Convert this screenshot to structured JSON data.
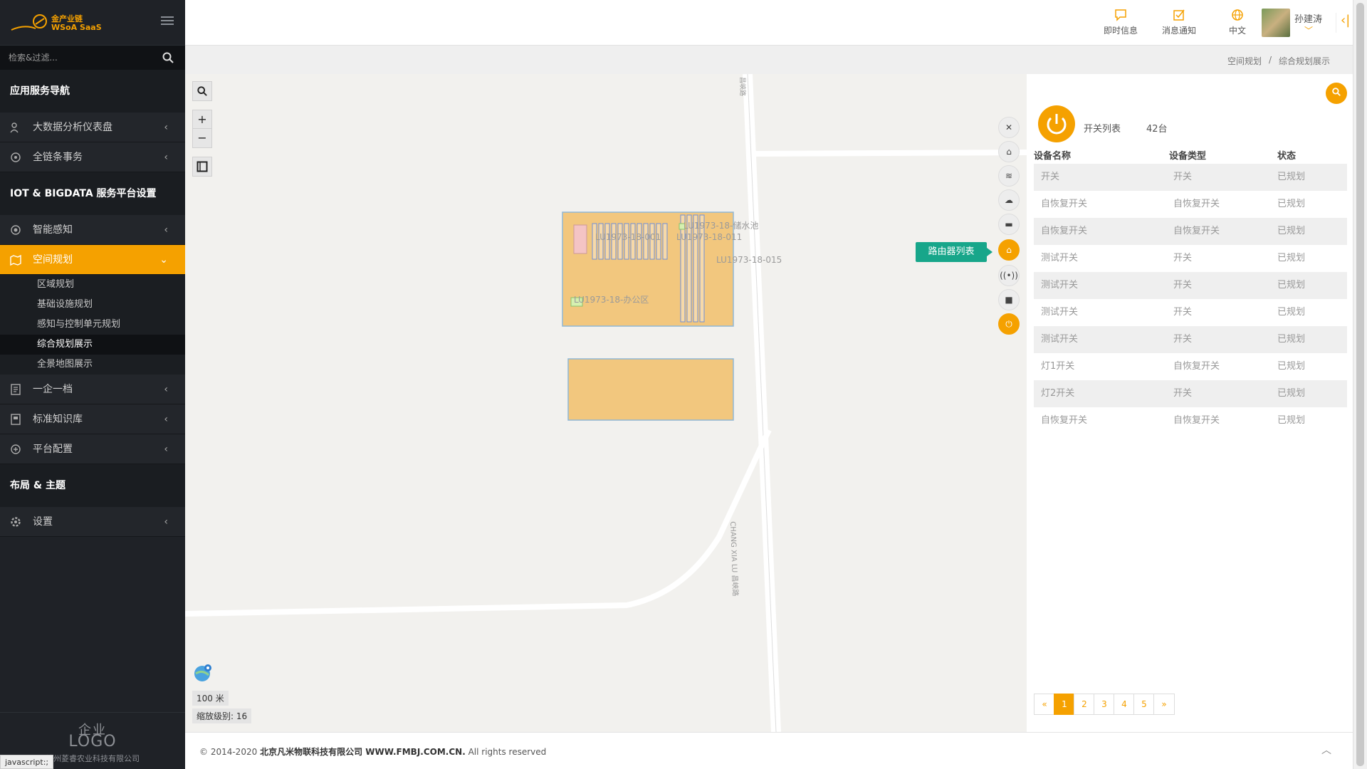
{
  "app": {
    "brand_line1": "金产业链",
    "brand_line2": "WSoA SaaS",
    "search_placeholder": "检索&过滤..."
  },
  "sidebar": {
    "section1": "应用服务导航",
    "item_bigdata": "大数据分析仪表盘",
    "item_chain": "全链条事务",
    "section2": "IOT & BIGDATA 服务平台设置",
    "item_sense": "智能感知",
    "item_space": "空间规划",
    "sub": [
      "区域规划",
      "基础设施规划",
      "感知与控制单元规划",
      "综合规划展示",
      "全景地图展示"
    ],
    "item_onefile": "一企一档",
    "item_kb": "标准知识库",
    "item_platform": "平台配置",
    "section3": "布局 & 主题",
    "item_settings": "设置",
    "bottom_logo1": "企业",
    "bottom_logo2": "LOGO",
    "bottom_company": "神州菱睿农业科技有限公司",
    "status": "javascript:;"
  },
  "header": {
    "instant": "即时信息",
    "notice": "消息通知",
    "lang": "中文",
    "user": "孙建涛"
  },
  "breadcrumb": {
    "parent": "空间规划",
    "sep": "/",
    "current": "综合规划展示"
  },
  "map": {
    "tooltip": "路由器列表",
    "labels": {
      "pool": "LU1973-18-储水池",
      "l001": "LU1973-18-001",
      "l011": "LU1973-18-011",
      "l015": "LU1973-18-015",
      "office": "LU1973-18-办公区",
      "road": "CHANG XIA LU 昌峡路",
      "road_top": "昌峡路"
    },
    "scale": "100 米",
    "zoom": "缩放级别: 16"
  },
  "panel": {
    "title": "开关列表",
    "count": "42台",
    "headers": [
      "设备名称",
      "设备类型",
      "状态"
    ],
    "rows": [
      [
        "开关",
        "开关",
        "已规划"
      ],
      [
        "自恢复开关",
        "自恢复开关",
        "已规划"
      ],
      [
        "自恢复开关",
        "自恢复开关",
        "已规划"
      ],
      [
        "测试开关",
        "开关",
        "已规划"
      ],
      [
        "测试开关",
        "开关",
        "已规划"
      ],
      [
        "测试开关",
        "开关",
        "已规划"
      ],
      [
        "测试开关",
        "开关",
        "已规划"
      ],
      [
        "灯1开关",
        "自恢复开关",
        "已规划"
      ],
      [
        "灯2开关",
        "开关",
        "已规划"
      ],
      [
        "自恢复开关",
        "自恢复开关",
        "已规划"
      ]
    ],
    "pager": [
      "«",
      "1",
      "2",
      "3",
      "4",
      "5",
      "»"
    ]
  },
  "footer": {
    "copy": "© 2014-2020",
    "company": "北京凡米物联科技有限公司 WWW.FMBJ.COM.CN.",
    "rights": "All rights reserved"
  },
  "colors": {
    "accent": "#f5a100",
    "sidebar": "#1f2227",
    "tooltip": "#17a68a",
    "plot_fill": "#f2c77e"
  }
}
